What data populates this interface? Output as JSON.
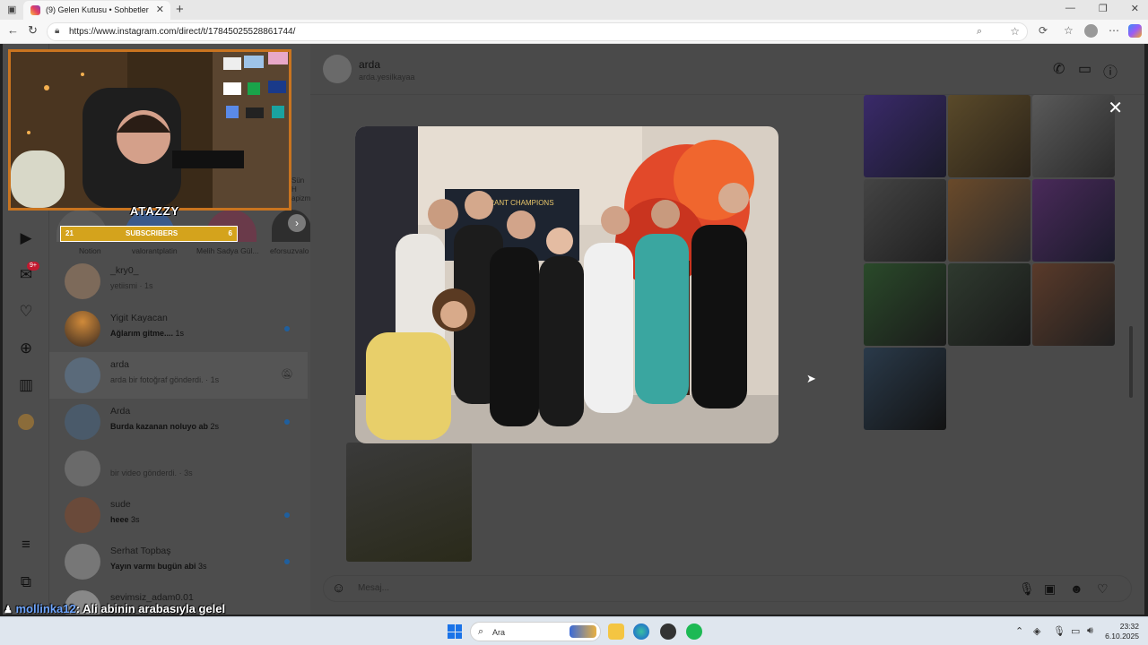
{
  "browser": {
    "tab_title": "(9) Gelen Kutusu • Sohbetler",
    "url": "https://www.instagram.com/direct/t/17845025528861744/"
  },
  "rail": {
    "notifications_badge": "9+"
  },
  "stories": [
    "Notion",
    "valorantplatin",
    "Melih Sadya Gül...",
    "eforsuzvalo"
  ],
  "story_partial": {
    "line1": "Sün H",
    "line2": "apizm"
  },
  "conversations": [
    {
      "name": "_kry0_",
      "preview": "yetiismi",
      "time": "1s",
      "bold": false,
      "unread": false
    },
    {
      "name": "Yigit Kayacan",
      "preview": "Ağlarım gitme....",
      "time": "1s",
      "bold": true,
      "unread": true
    },
    {
      "name": "arda",
      "preview": "arda bir fotoğraf gönderdi.",
      "time": "1s",
      "bold": false,
      "unread": false,
      "selected": true
    },
    {
      "name": "Arda",
      "preview": "Burda kazanan noluyo ab",
      "time": "2s",
      "bold": true,
      "unread": true
    },
    {
      "name": "",
      "preview": "bir video gönderdi.",
      "time": "3s",
      "bold": false,
      "unread": false
    },
    {
      "name": "sude",
      "preview": "heee",
      "time": "3s",
      "bold": true,
      "unread": true
    },
    {
      "name": "Serhat Topbaş",
      "preview": "Yayın varmı bugün abi",
      "time": "3s",
      "bold": true,
      "unread": true
    },
    {
      "name": "sevimsiz_adam0.01",
      "preview": "",
      "time": "",
      "bold": false,
      "unread": false
    }
  ],
  "chat": {
    "name": "arda",
    "username": "arda.yesilkayaa",
    "placeholder": "Mesaj..."
  },
  "overlay": {
    "streamer": "ATAZZY",
    "sub_left": "21",
    "sub_label": "SUBSCRIBERS",
    "sub_right": "6",
    "chat_user": "mollinka12",
    "chat_text": ": Ali abinin arabasıyla gelel"
  },
  "photo_sign": "VALORANT CHAMPIONS",
  "taskbar": {
    "search": "Ara",
    "time": "23:32",
    "date": "6.10.2025"
  },
  "colors": {
    "overlay_border": "#c9741f",
    "sub_bar": "#d4a31c",
    "unread_dot": "#1f5f9e"
  }
}
